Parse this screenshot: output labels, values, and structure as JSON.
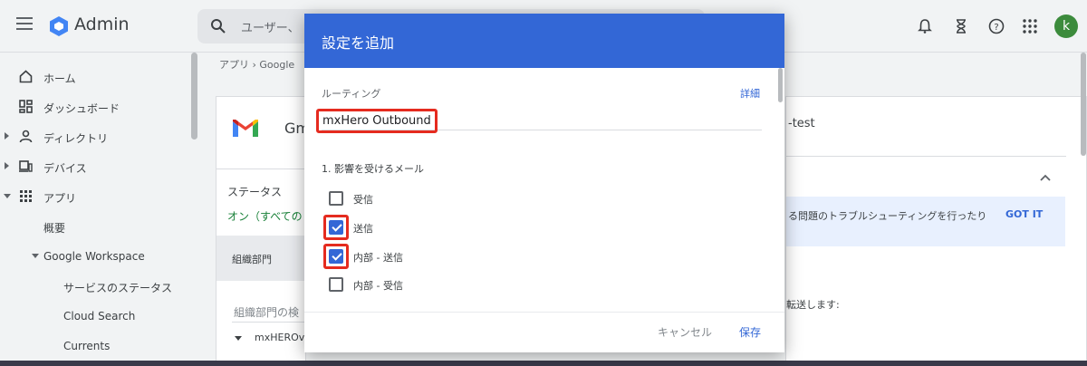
{
  "app": {
    "name": "Admin"
  },
  "search": {
    "placeholder": "ユーザー、"
  },
  "user": {
    "avatar_letter": "k"
  },
  "colors": {
    "accent": "#3367d6",
    "highlight": "#e52b1f",
    "avatar": "#3c8b3c"
  },
  "sidebar": {
    "items": [
      {
        "label": "ホーム",
        "icon": "home-icon"
      },
      {
        "label": "ダッシュボード",
        "icon": "dashboard-icon"
      },
      {
        "label": "ディレクトリ",
        "icon": "person-icon"
      },
      {
        "label": "デバイス",
        "icon": "devices-icon"
      },
      {
        "label": "アプリ",
        "icon": "apps-grid-icon"
      },
      {
        "label": "概要"
      },
      {
        "label": "Google Workspace"
      },
      {
        "label": "サービスのステータス"
      },
      {
        "label": "Cloud Search"
      },
      {
        "label": "Currents"
      }
    ]
  },
  "breadcrumb": {
    "text": "アプリ  ›  Google"
  },
  "background": {
    "service_title": "Gm",
    "status_label": "ステータス",
    "status_value": "オン（すべての",
    "org_unit_label": "組織部門",
    "org_search_placeholder": "組織部門の検",
    "org_unit_item": "mxHEROv",
    "right_title": "-test",
    "banner_text": "る問題のトラブルシューティングを行ったり",
    "banner_action": "GOT IT",
    "right_body": "転送します:"
  },
  "dialog": {
    "title": "設定を追加",
    "routing_label": "ルーティング",
    "detail_link": "詳細",
    "routing_name": "mxHero Outbound",
    "section_title": "1. 影響を受けるメール",
    "options": [
      {
        "label": "受信",
        "checked": false,
        "highlighted": false
      },
      {
        "label": "送信",
        "checked": true,
        "highlighted": true
      },
      {
        "label": "内部 - 送信",
        "checked": true,
        "highlighted": true
      },
      {
        "label": "内部 - 受信",
        "checked": false,
        "highlighted": false
      }
    ],
    "cancel_label": "キャンセル",
    "save_label": "保存"
  }
}
